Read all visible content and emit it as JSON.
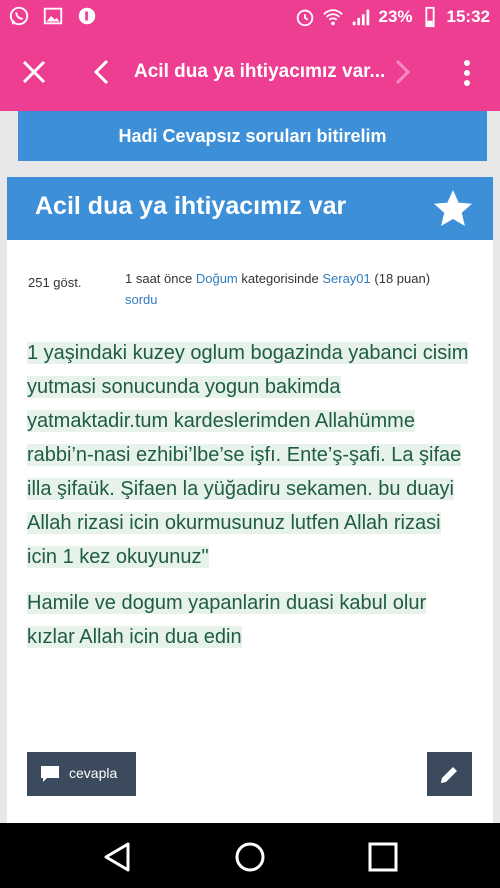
{
  "status_bar": {
    "battery_percent": "23%",
    "time": "15:32",
    "icons": [
      "whatsapp-icon",
      "gallery-icon",
      "notification-icon",
      "alarm-icon",
      "wifi-icon",
      "signal-icon",
      "battery-icon"
    ]
  },
  "app_bar": {
    "title": "Acil dua ya ihtiyacımız var..."
  },
  "banner": {
    "text": "Hadi Cevapsız soruları bitirelim"
  },
  "question": {
    "title": "Acil dua ya ihtiyacımız var",
    "views": "251 göst.",
    "time": "1 saat önce",
    "category": "Doğum",
    "category_suffix": "kategorisinde",
    "author": "Seray01",
    "points": "(18 puan)",
    "action": "sordu",
    "body_1": "1 yaşindaki kuzey oglum bogazinda yabanci cisim yutmasi sonucunda yogun bakimda yatmaktadir.tum kardeslerimden Allahümme rabbi’n-nasi ezhibi’lbe’se işfı. Ente’ş-şafi. La şifae illa şifaük. Şifaen la yüğadiru sekamen. bu duayi Allah rizasi icin okurmusunuz lutfen Allah rizasi icin 1 kez okuyunuz\"",
    "body_2": "Hamile ve dogum yapanlarin duasi kabul olur kızlar Allah icin dua edin"
  },
  "actions": {
    "reply_label": "cevapla"
  },
  "colors": {
    "accent": "#ee3e92",
    "blue": "#3d8fd8",
    "dark_button": "#3b4a5c",
    "body_text": "#1f5c44"
  }
}
